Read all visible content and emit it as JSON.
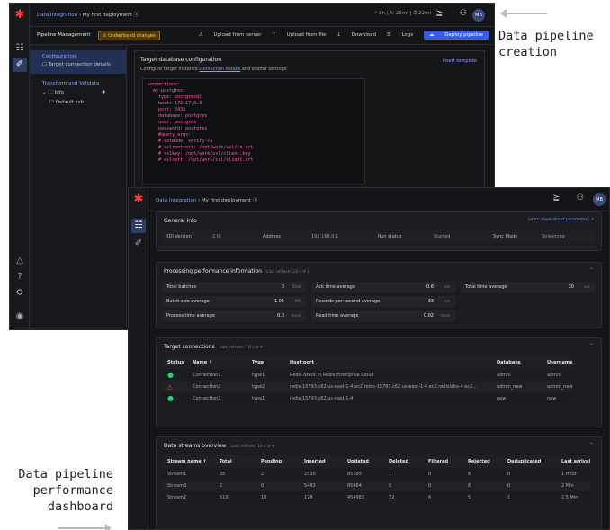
{
  "annotations": {
    "creation": "Data pipeline creation",
    "dashboard": "Data pipeline performance dashboard"
  },
  "back_window": {
    "breadcrumb_root": "Data Integration",
    "breadcrumb_sep": "›",
    "breadcrumb_current": "My first deployment",
    "stats": "⚡ 8h  |  ↻ 25ml  |  ⏱ 22ml",
    "subheader_title": "Pipeline Management",
    "undeployed_badge": "Undeployed changes",
    "actions": {
      "upload_server": "Upload from server",
      "upload_file": "Upload from file",
      "download": "Download",
      "logs": "Logs",
      "deploy": "Deploy pipeline"
    },
    "left": {
      "configuration": "Configuration",
      "target_details": "Target connection details",
      "transform": "Transform and Validate",
      "folder": "Info",
      "file": "Default.xsb"
    },
    "main": {
      "title": "Target database configuration",
      "subtitle_pre": "Configure target instance",
      "subtitle_link": "connection details",
      "subtitle_post": "and scaffer settings.",
      "hint": "Insert template",
      "code": "connections:\n  my-postgres:\n    type: postgresql\n    host: 172.17.0.3\n    port: 5432\n    database: postgres\n    user: postgres\n    password: postgres\n    #query_args:\n    # sslmode: verify-ca\n    # sslrootcert: /opt/work/ssl/ca.crt\n    # sslkey: /opt/work/ssl/client.key\n    # sslcert: /opt/work/ssl/client.crt"
    },
    "avatar": "MB"
  },
  "front_window": {
    "breadcrumb_root": "Data Integration",
    "breadcrumb_sep": "›",
    "breadcrumb_current": "My first deployment",
    "avatar": "MB",
    "general": {
      "title": "General info",
      "link": "Learn more about parameters ↗",
      "rdi_version_label": "RDI Version",
      "rdi_version": "2.0",
      "address_label": "Address",
      "address": "192.168.0.1",
      "run_status_label": "Run status",
      "run_status": "Started",
      "sync_mode_label": "Sync Mode",
      "sync_mode": "Streaming"
    },
    "processing": {
      "title": "Processing performance information",
      "refresh": "Last refresh: 10 s ⟳ ▾",
      "metrics": [
        {
          "label": "Total batches",
          "value": "3",
          "unit": "Total"
        },
        {
          "label": "Batch size average",
          "value": "1.05",
          "unit": "MB"
        },
        {
          "label": "Process time average",
          "value": "0.3",
          "unit": "msec"
        },
        {
          "label": "Ack time average",
          "value": "0.6",
          "unit": "sec"
        },
        {
          "label": "Records per second average",
          "value": "33",
          "unit": "sec"
        },
        {
          "label": "Read time average",
          "value": "0.02",
          "unit": "msec"
        },
        {
          "label": "Total time average",
          "value": "30",
          "unit": "sec"
        }
      ]
    },
    "targets": {
      "title": "Target connections",
      "refresh": "Last refresh: 10 s ⟳ ▾",
      "columns": [
        "Status",
        "Name ↑",
        "Type",
        "Host:port",
        "Database",
        "Username"
      ],
      "rows": [
        {
          "status": "ok",
          "name": "Connection1",
          "type": "type1",
          "host": "Redis-Stack in Redis Enterprise Cloud",
          "database": "admin",
          "username": "admin"
        },
        {
          "status": "warn",
          "name": "Connection2",
          "type": "type2",
          "host": "redis-15793.c62.us-east-1-4.ec2.redis-15797.c62.us-east-1-4.ec2.redislabs-4.ec2...",
          "database": "admin_new",
          "username": "admin_new"
        },
        {
          "status": "ok",
          "name": "Connection3",
          "type": "type1",
          "host": "redis-15793.c62.us-east-1-4",
          "database": "new",
          "username": "new"
        }
      ]
    },
    "streams": {
      "title": "Data streams overview",
      "refresh": "Last refresh: 10 s ⟳ ▾",
      "columns": [
        "Stream name ↑",
        "Total",
        "Pending",
        "Inserted",
        "Updated",
        "Deleted",
        "Filtered",
        "Rejected",
        "Deduplicated",
        "Last arrival"
      ],
      "rows": [
        [
          "Stream1",
          "35",
          "2",
          "2530",
          "85185",
          "1",
          "0",
          "6",
          "0",
          "1 Hour"
        ],
        [
          "Stream3",
          "2",
          "0",
          "5483",
          "85484",
          "6",
          "0",
          "8",
          "0",
          "2 Min"
        ],
        [
          "Stream2",
          "510",
          "10",
          "178",
          "454983",
          "22",
          "6",
          "5",
          "1",
          "2.5 Min"
        ]
      ]
    }
  },
  "colors": {
    "accent": "#3a5ae8",
    "link": "#7fa2ff",
    "logo": "#ff3b3b",
    "ok": "#2ecc71",
    "warn": "#ff4d4d",
    "code": "#ff5ab0"
  }
}
